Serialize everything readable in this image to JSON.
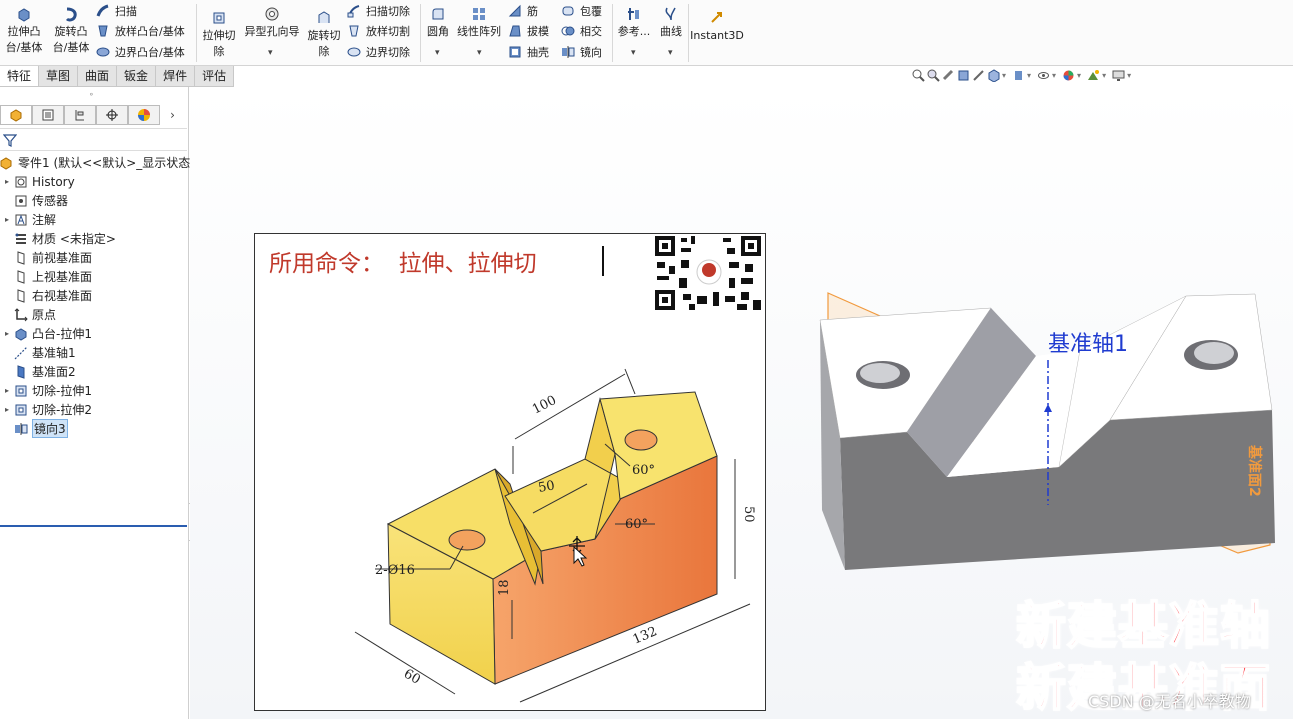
{
  "ribbon": {
    "extrude_boss": "拉伸凸台/基体",
    "revolve_boss": "旋转凸台/基体",
    "sweep": "扫描",
    "loft_boss": "放样凸台/基体",
    "boundary_boss": "边界凸台/基体",
    "extrude_cut": "拉伸切除",
    "hole_wizard": "异型孔向导",
    "revolve_cut": "旋转切除",
    "swept_cut": "扫描切除",
    "lofted_cut": "放样切割",
    "boundary_cut": "边界切除",
    "fillet": "圆角",
    "linear_pattern": "线性阵列",
    "rib": "筋",
    "draft": "拔模",
    "shell": "抽壳",
    "wrap": "包覆",
    "intersect": "相交",
    "mirror": "镜向",
    "reference": "参考...",
    "curves": "曲线",
    "instant3d": "Instant3D"
  },
  "tabs": [
    "特征",
    "草图",
    "曲面",
    "钣金",
    "焊件",
    "评估"
  ],
  "tree": {
    "root": "零件1 (默认<<默认>_显示状态",
    "items": [
      "History",
      "传感器",
      "注解",
      "材质 <未指定>",
      "前视基准面",
      "上视基准面",
      "右视基准面",
      "原点",
      "凸台-拉伸1",
      "基准轴1",
      "基准面2",
      "切除-拉伸1",
      "切除-拉伸2",
      "镜向3"
    ]
  },
  "reference": {
    "title": "所用命令：  拉伸、拉伸切",
    "dims": [
      "100",
      "50",
      "60°",
      "60°",
      "50",
      "2-Ø16",
      "18",
      "132",
      "60"
    ]
  },
  "viewport": {
    "axis_label": "基准轴1",
    "plane_label": "基准面2"
  },
  "overlay": {
    "line1": "新建基准轴",
    "line2": "新建基准面"
  },
  "watermark": "CSDN @无名小卒教物"
}
